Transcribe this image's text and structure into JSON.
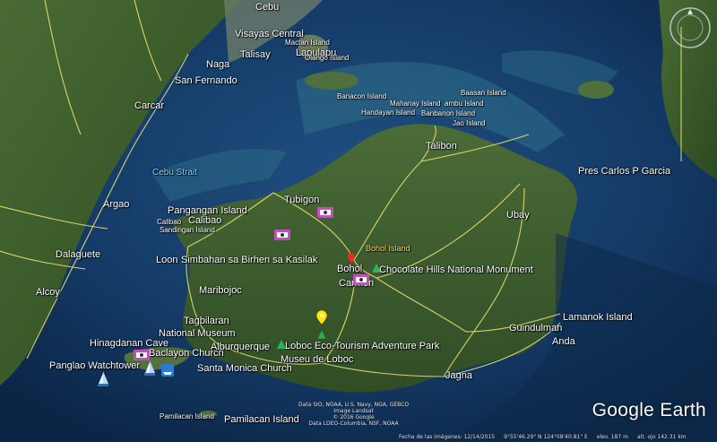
{
  "map": {
    "labels": {
      "cebu": "Cebu",
      "visayas_central": "Visayas Central",
      "mactan_island": "Mactan Island",
      "talisay": "Talisay",
      "lapulapu": "Lapulapu",
      "olango": "Olango Island",
      "naga": "Naga",
      "san_fernando": "San Fernando",
      "carcar": "Carcar",
      "cebu_strait": "Cebu Strait",
      "argao": "Argao",
      "dalaguete": "Dalaguete",
      "alcoy": "Alcoy",
      "banacon": "Banacon Island",
      "mahanay": "Mahanay Island",
      "lambu": "ambu Island",
      "baasan": "Baasan Island",
      "handayan": "Handayan Island",
      "banbanon": "Banbanon Island",
      "jao": "Jao Island",
      "talibon": "Talibon",
      "pres_garcia": "Pres Carlos P Garcia",
      "tubigon": "Tubigon",
      "pangangan": "Pangangan Island",
      "calibao": "Calibao",
      "calibao_small": "Calibao",
      "sandingan": "Sandingan Island",
      "ubay": "Ubay",
      "bohol_island": "Bohol Island",
      "loon": "Loon",
      "simbahan": "Simbahan sa Birhen sa Kasilak",
      "bohol": "Bohol",
      "chocolate_hills": "Chocolate Hills National Monument",
      "carmen": "Carmen",
      "maribojoc": "Maribojoc",
      "tagbilaran": "Tagbilaran",
      "national_museum": "National Museum",
      "hinagdanan": "Hinagdanan Cave",
      "baclayon": "Baclayon Church",
      "alburquerque": "Alburquerque",
      "loboc_park": "Loboc Eco-Tourism Adventure Park",
      "museu_loboc": "Museu de Loboc",
      "panglao_watchtower": "Panglao Watchtower",
      "santa_monica": "Santa Monica Church",
      "guindulman": "Guindulman",
      "lamanok": "Lamanok Island",
      "anda": "Anda",
      "jagna": "Jagna",
      "pamilacan": "Pamilacan Island",
      "pamilacan_small": "Pamilacan Island"
    }
  },
  "credits": {
    "line1": "Data SIO, NOAA, U.S. Navy, NGA, GEBCO",
    "line2": "Image Landsat",
    "line3": "© 2016 Google",
    "line4": "Data LDEO-Columbia, NSF, NOAA"
  },
  "brand": "Google Earth",
  "status": {
    "imagery_date": "Fecha de las imágenes: 12/14/2015",
    "coords": "9°55'46.29\" N  124°08'40.81\" E",
    "elev": "elev.  187 m",
    "eye_alt": "alt. ojo 142.31 km"
  },
  "colors": {
    "sea": "#0b2a4a",
    "land": "#3c5a2a",
    "road": "#e8e070",
    "label": "#ffffff"
  }
}
